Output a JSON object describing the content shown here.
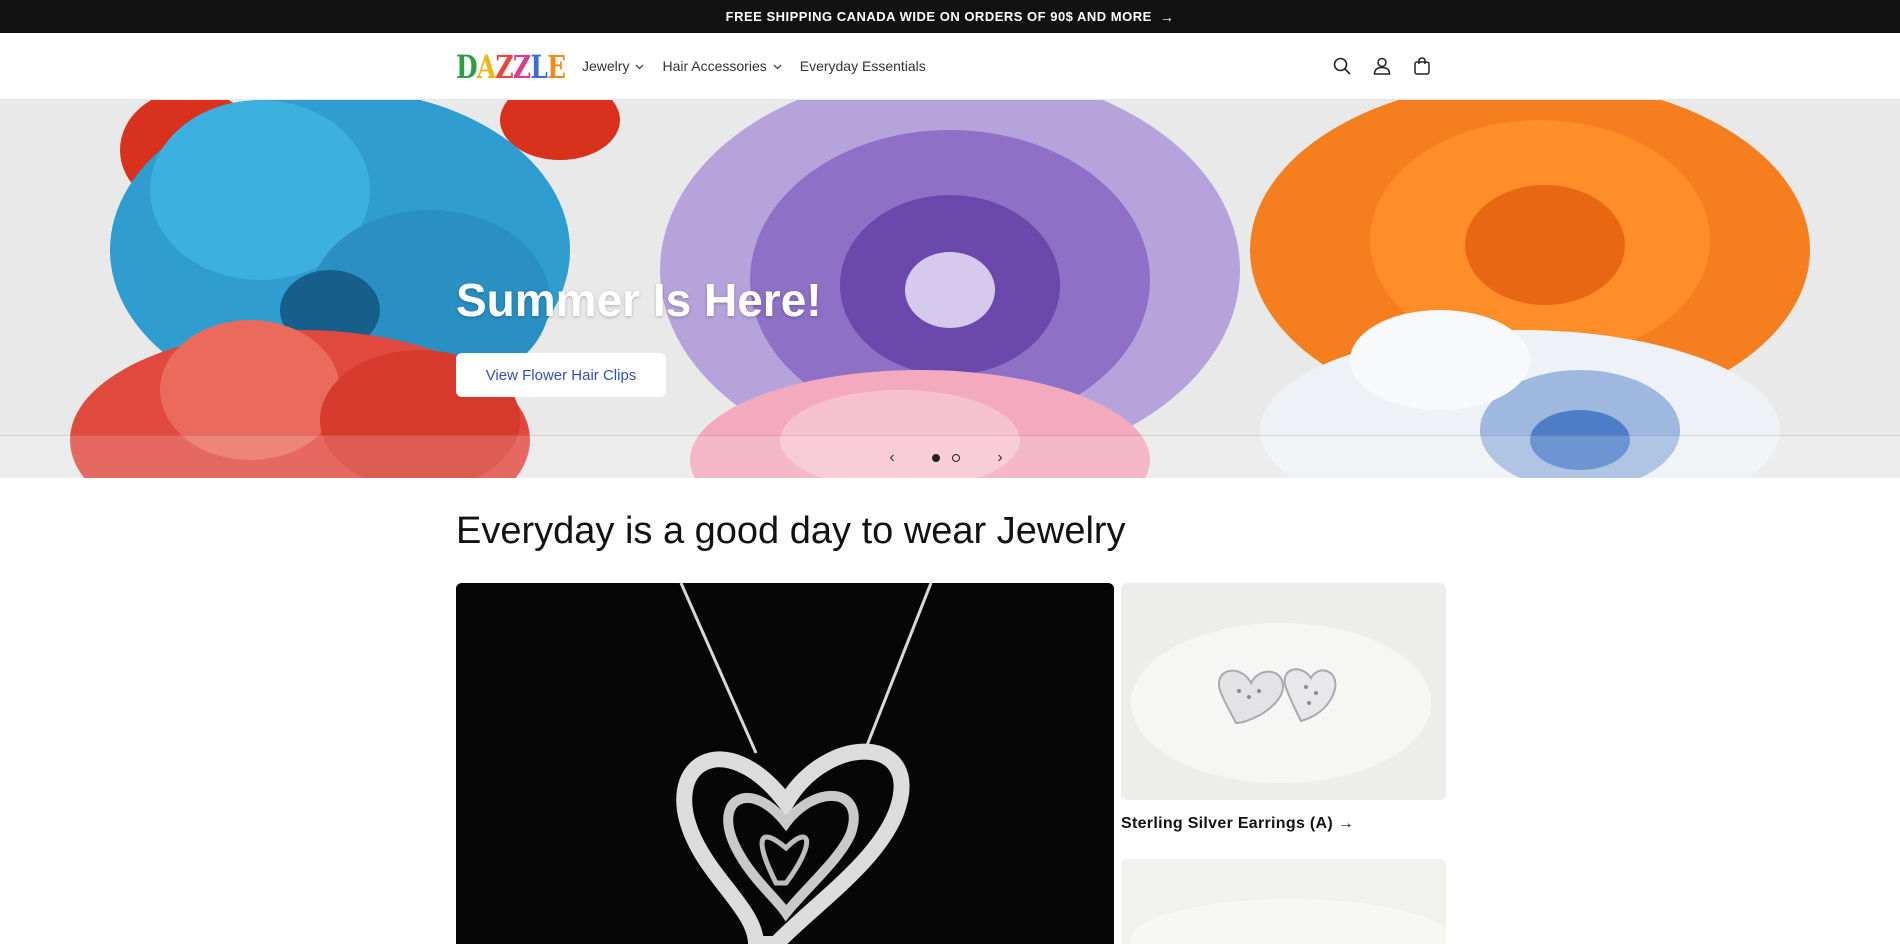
{
  "announcement": {
    "text": "FREE SHIPPING CANADA WIDE ON ORDERS OF 90$ AND MORE",
    "arrow": "→"
  },
  "header": {
    "logo": {
      "letters": [
        "D",
        "A",
        "Z",
        "Z",
        "L",
        "E"
      ],
      "colors": [
        "#2e9b47",
        "#f0b51c",
        "#e8463a",
        "#d83c8f",
        "#3b6fd1",
        "#f28a1e"
      ]
    },
    "nav": [
      {
        "label": "Jewelry",
        "has_dropdown": true
      },
      {
        "label": "Hair Accessories",
        "has_dropdown": true
      },
      {
        "label": "Everyday Essentials",
        "has_dropdown": false
      }
    ],
    "icons": [
      "search-icon",
      "account-icon",
      "cart-icon"
    ]
  },
  "hero": {
    "title": "Summer Is Here!",
    "button_label": "View Flower Hair Clips",
    "slides_total": 2,
    "active_slide": 1,
    "prev_arrow": "‹",
    "next_arrow": "›"
  },
  "collection": {
    "title": "Everyday is a good day to wear Jewelry",
    "items": [
      {
        "title": "Sterling Silver Earrings (A)",
        "arrow": "→"
      }
    ]
  },
  "colors": {
    "announcement_bg": "#121212",
    "button_text": "#334fb4"
  }
}
